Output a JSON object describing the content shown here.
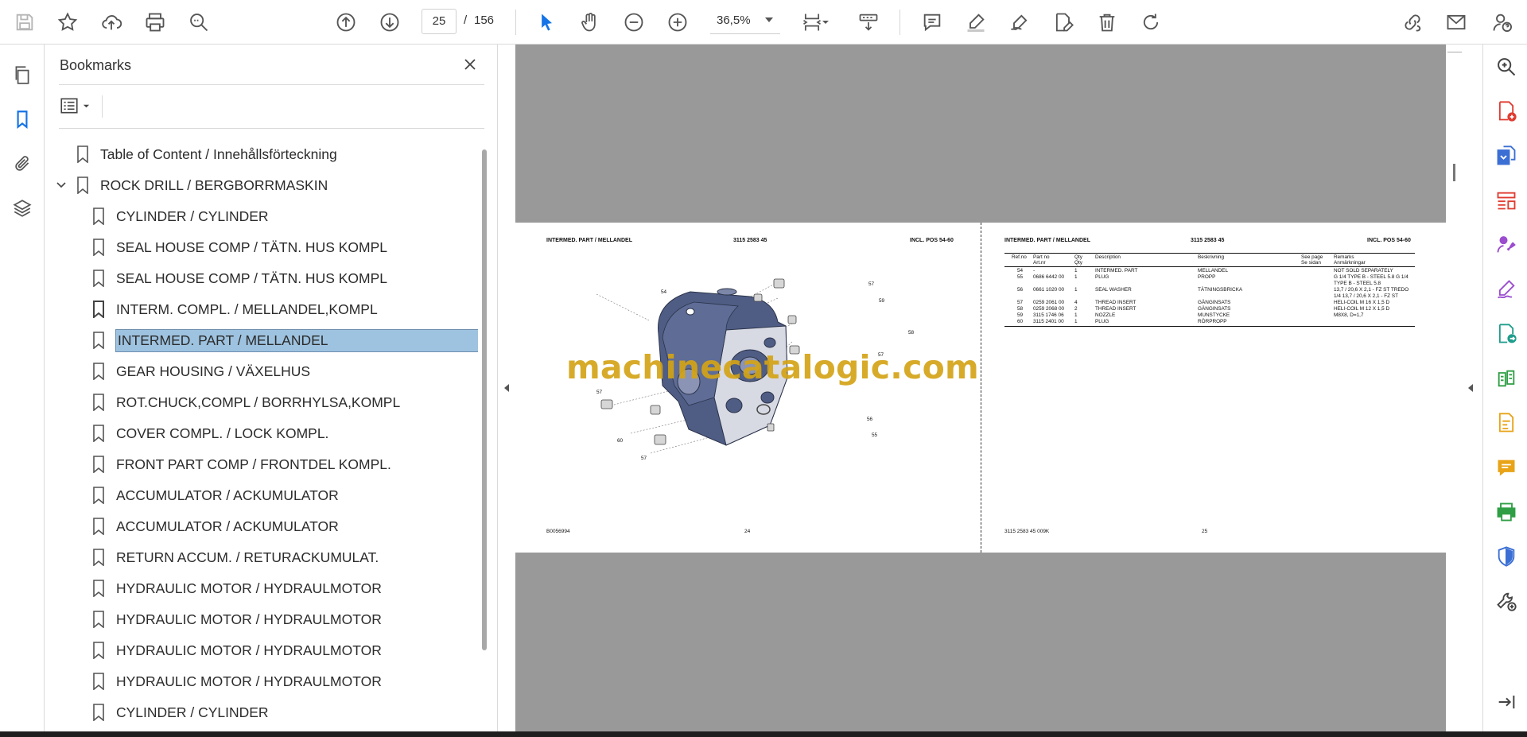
{
  "toolbar": {
    "page_current": "25",
    "page_separator": "/",
    "page_total": "156",
    "zoom": "36,5%"
  },
  "bookmarks": {
    "title": "Bookmarks",
    "items": [
      {
        "label": "Table of Content / Innehållsförteckning"
      },
      {
        "label": "ROCK DRILL / BERGBORRMASKIN"
      },
      {
        "label": "CYLINDER / CYLINDER"
      },
      {
        "label": "SEAL HOUSE COMP  / TÄTN. HUS KOMPL"
      },
      {
        "label": "SEAL HOUSE COMP  / TÄTN. HUS KOMPL"
      },
      {
        "label": "INTERM. COMPL. / MELLANDEL,KOMPL"
      },
      {
        "label": "INTERMED. PART / MELLANDEL"
      },
      {
        "label": "GEAR HOUSING / VÄXELHUS"
      },
      {
        "label": "ROT.CHUCK,COMPL  / BORRHYLSA,KOMPL"
      },
      {
        "label": "COVER COMPL. / LOCK KOMPL."
      },
      {
        "label": "FRONT PART COMP  / FRONTDEL KOMPL."
      },
      {
        "label": "ACCUMULATOR / ACKUMULATOR"
      },
      {
        "label": "ACCUMULATOR / ACKUMULATOR"
      },
      {
        "label": "RETURN ACCUM. / RETURACKUMULAT."
      },
      {
        "label": "HYDRAULIC MOTOR  / HYDRAULMOTOR"
      },
      {
        "label": "HYDRAULIC MOTOR  / HYDRAULMOTOR"
      },
      {
        "label": "HYDRAULIC MOTOR  / HYDRAULMOTOR"
      },
      {
        "label": "HYDRAULIC MOTOR  / HYDRAULMOTOR"
      },
      {
        "label": "CYLINDER / CYLINDER"
      }
    ]
  },
  "left_page": {
    "title": "INTERMED. PART / MELLANDEL",
    "part_no": "3115 2583 45",
    "incl": "INCL. POS 54-60",
    "footer_left": "B0056994",
    "footer_page": "24",
    "callouts": [
      "54",
      "57",
      "59",
      "58",
      "57",
      "57",
      "60",
      "57",
      "56",
      "55"
    ]
  },
  "right_page": {
    "title": "INTERMED. PART / MELLANDEL",
    "part_no": "3115 2583 45",
    "incl": "INCL. POS 54-60",
    "footer_left": "3115 2583 45 009K",
    "footer_page": "25",
    "headers": {
      "ref": "Ref.no",
      "part": "Part no",
      "part_sv": "Art.nr",
      "qty": "Qty",
      "qty_sv": "Qty",
      "desc": "Description",
      "besk": "Beskrivning",
      "see": "See page",
      "see_sv": "Se sidan",
      "rem": "Remarks",
      "rem_sv": "Anmärkningar"
    },
    "rows": [
      {
        "ref": "54",
        "part": "-",
        "qty": "1",
        "desc": "INTERMED. PART",
        "besk": "MELLANDEL",
        "rem": "NOT SOLD SEPARATELY"
      },
      {
        "ref": "55",
        "part": "0686 6442 00",
        "qty": "1",
        "desc": "PLUG",
        "besk": "PROPP",
        "rem": "G 1/4 TYPE B - STEEL 5.8 G 1/4"
      },
      {
        "ref": "",
        "part": "",
        "qty": "",
        "desc": "",
        "besk": "",
        "rem": "TYPE B - STEEL 5.8"
      },
      {
        "ref": "56",
        "part": "0661 1020 00",
        "qty": "1",
        "desc": "SEAL WASHER",
        "besk": "TÄTNINGSBRICKA",
        "rem": "13,7 / 20,6 X 2,1 - FZ ST TREDO"
      },
      {
        "ref": "",
        "part": "",
        "qty": "",
        "desc": "",
        "besk": "",
        "rem": "1/4 13,7 / 20,6 X 2,1 - FZ ST"
      },
      {
        "ref": "57",
        "part": "0259 2061 00",
        "qty": "4",
        "desc": "THREAD INSERT",
        "besk": "GÄNGINSATS",
        "rem": "HELI-COIL M 16 X 1,5 D"
      },
      {
        "ref": "58",
        "part": "0259 2068 00",
        "qty": "2",
        "desc": "THREAD INSERT",
        "besk": "GÄNGINSATS",
        "rem": "HELI-COIL M 12 X 1,5 D"
      },
      {
        "ref": "59",
        "part": "3115 1746 06",
        "qty": "1",
        "desc": "NOZZLE",
        "besk": "MUNSTYCKE",
        "rem": "M8X8, D=1,7"
      },
      {
        "ref": "60",
        "part": "3115 2401 00",
        "qty": "1",
        "desc": "PLUG",
        "besk": "RÖRPROPP",
        "rem": ""
      }
    ]
  },
  "watermark": "machinecatalogic.com",
  "colors": {
    "accent": "#1473e6",
    "selection": "#9ec3e0",
    "workspace": "#999999",
    "watermark": "#d4a417",
    "part_blue": "#4f5d85"
  }
}
